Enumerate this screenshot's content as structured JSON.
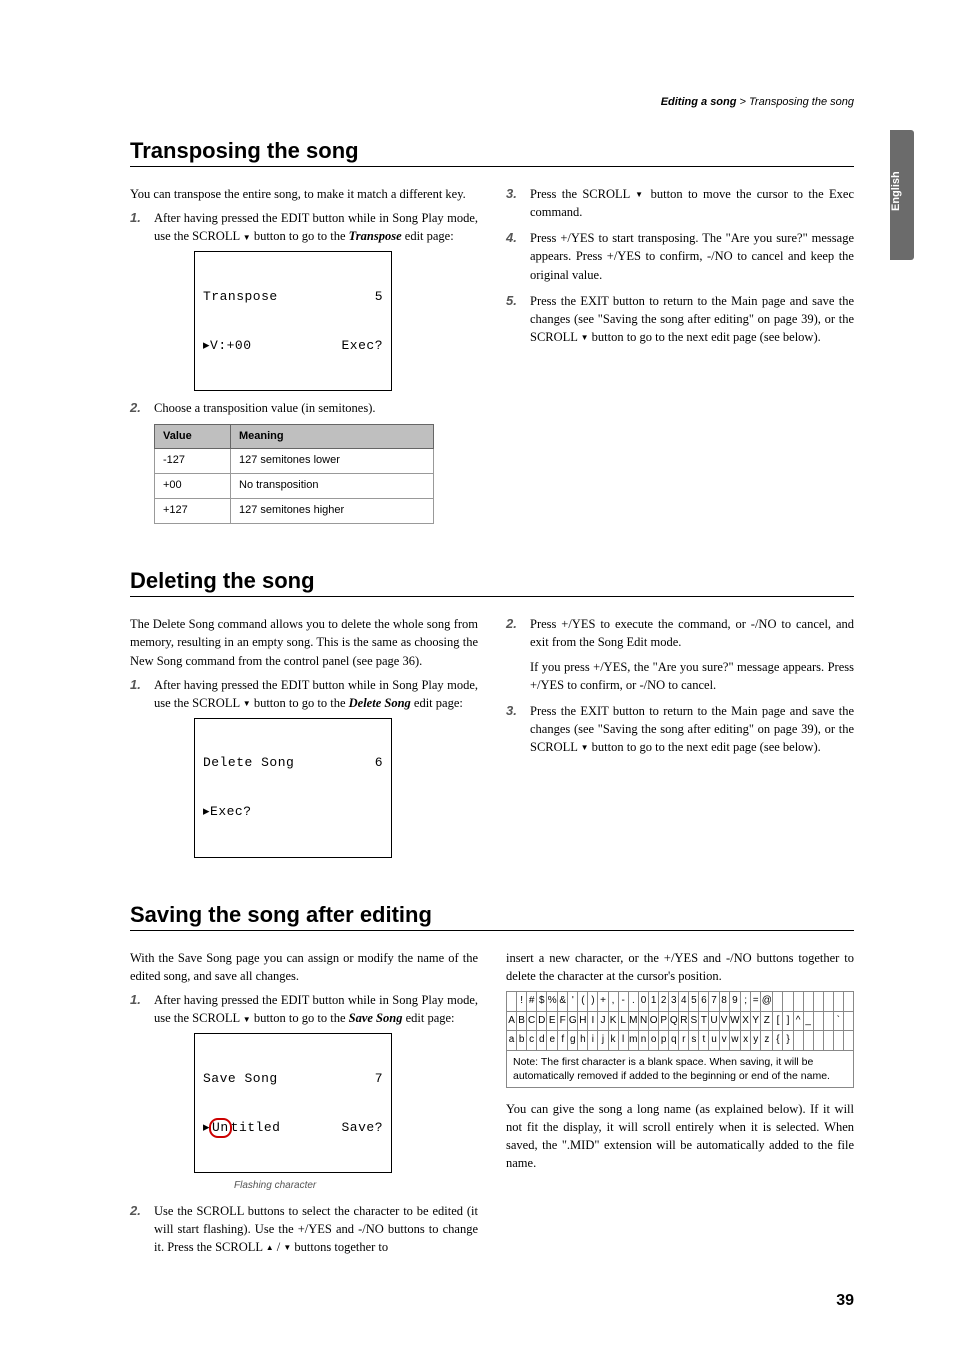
{
  "breadcrumb": {
    "section": "Editing a song",
    "sep": " > ",
    "page": "Transposing the song"
  },
  "side_tab": "English",
  "s1": {
    "title": "Transposing the song",
    "intro": "You can transpose the entire song, to make it match a different key.",
    "step1a": "After having pressed the EDIT button while in Song Play mode, use the SCROLL ",
    "step1b": " button to go to the ",
    "step1_target": "Transpose",
    "step1c": " edit page:",
    "lcd_l1_left": "Transpose",
    "lcd_l1_right": "5",
    "lcd_l2_left": "▸V:+00",
    "lcd_l2_right": "Exec?",
    "step2": "Choose a transposition value (in semitones).",
    "table": {
      "h1": "Value",
      "h2": "Meaning",
      "rows": [
        {
          "v": "-127",
          "m": "127 semitones lower"
        },
        {
          "v": "+00",
          "m": "No transposition"
        },
        {
          "v": "+127",
          "m": "127 semitones higher"
        }
      ]
    },
    "step3a": "Press the SCROLL ",
    "step3b": " button to move the cursor to the Exec command.",
    "step4": "Press +/YES to start transposing. The \"Are you sure?\" message appears. Press +/YES to confirm, -/NO to cancel and keep the original value.",
    "step5a": "Press the EXIT button to return to the Main page and save the changes (see \"Saving the song after editing\" on page 39), or the SCROLL ",
    "step5b": " button to go to the next edit page (see below)."
  },
  "s2": {
    "title": "Deleting the song",
    "intro": "The Delete Song command allows you to delete the whole song from memory, resulting in an empty song. This is the same as choosing the New Song command from the control panel (see page 36).",
    "step1a": "After having pressed the EDIT button while in Song Play mode, use the SCROLL ",
    "step1b": " button to go to the ",
    "step1_target": "Delete Song",
    "step1c": " edit page:",
    "lcd_l1_left": "Delete Song",
    "lcd_l1_right": "6",
    "lcd_l2_left": "▸Exec?",
    "lcd_l2_right": "",
    "step2": "Press +/YES to execute the command, or -/NO to cancel, and exit from the Song Edit mode.",
    "step2b": "If you press +/YES, the \"Are you sure?\" message appears. Press +/YES to confirm, or -/NO to cancel.",
    "step3a": "Press the EXIT button to return to the Main page and save the changes (see \"Saving the song after editing\" on page 39), or the SCROLL ",
    "step3b": " button to go to the next edit page (see below)."
  },
  "s3": {
    "title": "Saving the song after editing",
    "intro": "With the Save Song page you can assign or modify the name of the edited song, and save all changes.",
    "step1a": "After having pressed the EDIT button while in Song Play mode, use the SCROLL ",
    "step1b": " button to go to the ",
    "step1_target": "Save Song",
    "step1c": " edit page:",
    "lcd_l1_left": "Save Song",
    "lcd_l1_right": "7",
    "lcd_l2_marker": "▸",
    "lcd_l2_hot": "Un",
    "lcd_l2_rest": "titled",
    "lcd_l2_right": "Save?",
    "lcd_caption": "Flashing character",
    "step2a": "Use the SCROLL buttons to select the character to be edited (it will start flashing). Use the +/YES and -/NO buttons to change it. Press the SCROLL ",
    "step2b": " buttons together to",
    "rightA": "insert a new character, or the +/YES and -/NO buttons together to delete the character at the cursor's position.",
    "note": "Note: The first character is a blank space. When saving, it will be automatically removed if added to the beginning or end of the name.",
    "rightB": "You can give the song a long name (as explained below). If it will not fit the display, it will scroll entirely when it is selected. When saved, the \".MID\" extension will be automatically added to the file name.",
    "charset": {
      "row1": [
        "",
        "!",
        "#",
        "$",
        "%",
        "&",
        "'",
        "(",
        ")",
        "+",
        ",",
        "-",
        ".",
        "0",
        "1",
        "2",
        "3",
        "4",
        "5",
        "6",
        "7",
        "8",
        "9",
        ";",
        "=",
        "@",
        "",
        "",
        "",
        "",
        "",
        "",
        "",
        ""
      ],
      "row2": [
        "A",
        "B",
        "C",
        "D",
        "E",
        "F",
        "G",
        "H",
        "I",
        "J",
        "K",
        "L",
        "M",
        "N",
        "O",
        "P",
        "Q",
        "R",
        "S",
        "T",
        "U",
        "V",
        "W",
        "X",
        "Y",
        "Z",
        "[",
        "]",
        "^",
        "_",
        "",
        "",
        "`",
        ""
      ],
      "row3": [
        "a",
        "b",
        "c",
        "d",
        "e",
        "f",
        "g",
        "h",
        "i",
        "j",
        "k",
        "l",
        "m",
        "n",
        "o",
        "p",
        "q",
        "r",
        "s",
        "t",
        "u",
        "v",
        "w",
        "x",
        "y",
        "z",
        "{",
        "}",
        "",
        "",
        "",
        "",
        "",
        ""
      ]
    }
  },
  "page_number": "39"
}
